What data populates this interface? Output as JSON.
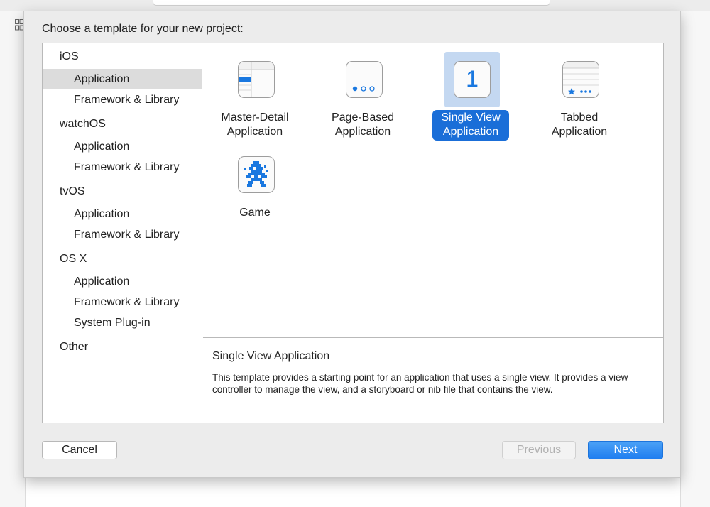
{
  "sheet": {
    "title": "Choose a template for your new project:"
  },
  "sidebar": {
    "items": [
      {
        "label": "iOS",
        "kind": "platform"
      },
      {
        "label": "Application",
        "kind": "sub",
        "selected": true
      },
      {
        "label": "Framework & Library",
        "kind": "sub"
      },
      {
        "label": "watchOS",
        "kind": "platform"
      },
      {
        "label": "Application",
        "kind": "sub"
      },
      {
        "label": "Framework & Library",
        "kind": "sub"
      },
      {
        "label": "tvOS",
        "kind": "platform"
      },
      {
        "label": "Application",
        "kind": "sub"
      },
      {
        "label": "Framework & Library",
        "kind": "sub"
      },
      {
        "label": "OS X",
        "kind": "platform"
      },
      {
        "label": "Application",
        "kind": "sub"
      },
      {
        "label": "Framework & Library",
        "kind": "sub"
      },
      {
        "label": "System Plug-in",
        "kind": "sub"
      },
      {
        "label": "Other",
        "kind": "platform"
      }
    ]
  },
  "templates": [
    {
      "line1": "Master-Detail",
      "line2": "Application",
      "icon": "master-detail-icon"
    },
    {
      "line1": "Page-Based",
      "line2": "Application",
      "icon": "page-dots-icon"
    },
    {
      "line1": "Single View",
      "line2": "Application",
      "icon": "single-view-icon",
      "glyph": "1",
      "selected": true
    },
    {
      "line1": "Tabbed",
      "line2": "Application",
      "icon": "tabbed-icon"
    },
    {
      "line1": "Game",
      "line2": "",
      "icon": "game-spaceship-icon"
    }
  ],
  "description": {
    "title": "Single View Application",
    "body": "This template provides a starting point for an application that uses a single view. It provides a view controller to manage the view, and a storyboard or nib file that contains the view."
  },
  "buttons": {
    "cancel": "Cancel",
    "previous": "Previous",
    "next": "Next"
  },
  "colors": {
    "accent": "#1a6ed8",
    "selection_highlight": "#c4d8f1",
    "sidebar_selection": "#dcdcdc",
    "disabled_text": "#b1b1b1"
  }
}
